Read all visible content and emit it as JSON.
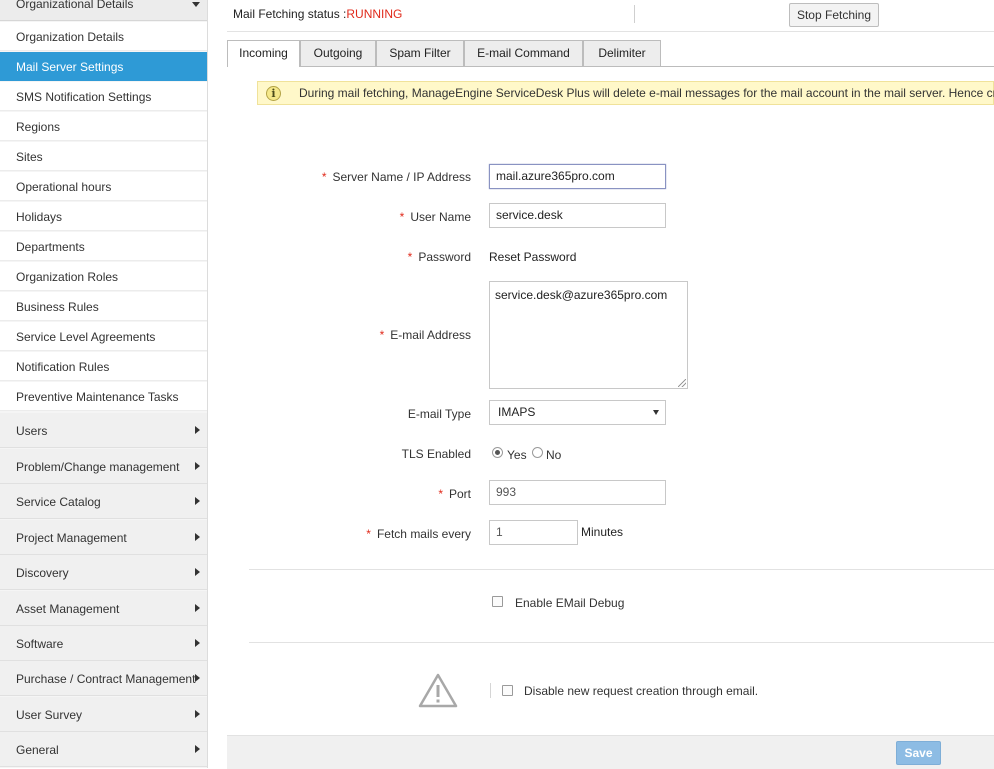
{
  "sidebar": {
    "section_title": "Organizational Details",
    "sub_items": [
      {
        "label": "Organization Details",
        "active": false
      },
      {
        "label": "Mail Server Settings",
        "active": true
      },
      {
        "label": "SMS Notification Settings",
        "active": false
      },
      {
        "label": "Regions",
        "active": false
      },
      {
        "label": "Sites",
        "active": false
      },
      {
        "label": "Operational hours",
        "active": false
      },
      {
        "label": "Holidays",
        "active": false
      },
      {
        "label": "Departments",
        "active": false
      },
      {
        "label": "Organization Roles",
        "active": false
      },
      {
        "label": "Business Rules",
        "active": false
      },
      {
        "label": "Service Level Agreements",
        "active": false
      },
      {
        "label": "Notification Rules",
        "active": false
      },
      {
        "label": "Preventive Maintenance Tasks",
        "active": false
      }
    ],
    "categories": [
      {
        "label": "Users"
      },
      {
        "label": "Problem/Change management"
      },
      {
        "label": "Service Catalog"
      },
      {
        "label": "Project Management"
      },
      {
        "label": "Discovery"
      },
      {
        "label": "Asset Management"
      },
      {
        "label": "Software"
      },
      {
        "label": "Purchase / Contract Management"
      },
      {
        "label": "User Survey"
      },
      {
        "label": "General"
      }
    ]
  },
  "status": {
    "label": "Mail Fetching status :",
    "value": "RUNNING",
    "value_color": "#e02a1b",
    "stop_button": "Stop Fetching"
  },
  "tabs": [
    {
      "label": "Incoming",
      "active": true
    },
    {
      "label": "Outgoing",
      "active": false
    },
    {
      "label": "Spam Filter",
      "active": false
    },
    {
      "label": "E-mail Command",
      "active": false
    },
    {
      "label": "Delimiter",
      "active": false
    }
  ],
  "info": {
    "icon": "info-icon",
    "text": "During mail fetching, ManageEngine ServiceDesk Plus will delete e-mail messages for the mail account in the mail server. Hence create"
  },
  "form": {
    "required_mark": "*",
    "server": {
      "label": "Server Name / IP Address",
      "value": "mail.azure365pro.com"
    },
    "user": {
      "label": "User Name",
      "value": "service.desk"
    },
    "password": {
      "label": "Password",
      "link": "Reset Password"
    },
    "email": {
      "label": "E-mail Address",
      "value": "service.desk@azure365pro.com"
    },
    "email_type": {
      "label": "E-mail Type",
      "selected": "IMAPS"
    },
    "tls": {
      "label": "TLS Enabled",
      "yes": "Yes",
      "no": "No",
      "selected": "Yes"
    },
    "port": {
      "label": "Port",
      "value": "993"
    },
    "fetch": {
      "label": "Fetch mails every",
      "value": "1",
      "unit": "Minutes"
    },
    "debug": {
      "label": "Enable EMail Debug",
      "checked": false
    },
    "disable_new": {
      "label": "Disable new request creation through email.",
      "checked": false
    }
  },
  "footer": {
    "save": "Save"
  },
  "colors": {
    "accent": "#2e9ad6",
    "save_button": "#8dbce4",
    "info_bg": "#fff8c9"
  }
}
